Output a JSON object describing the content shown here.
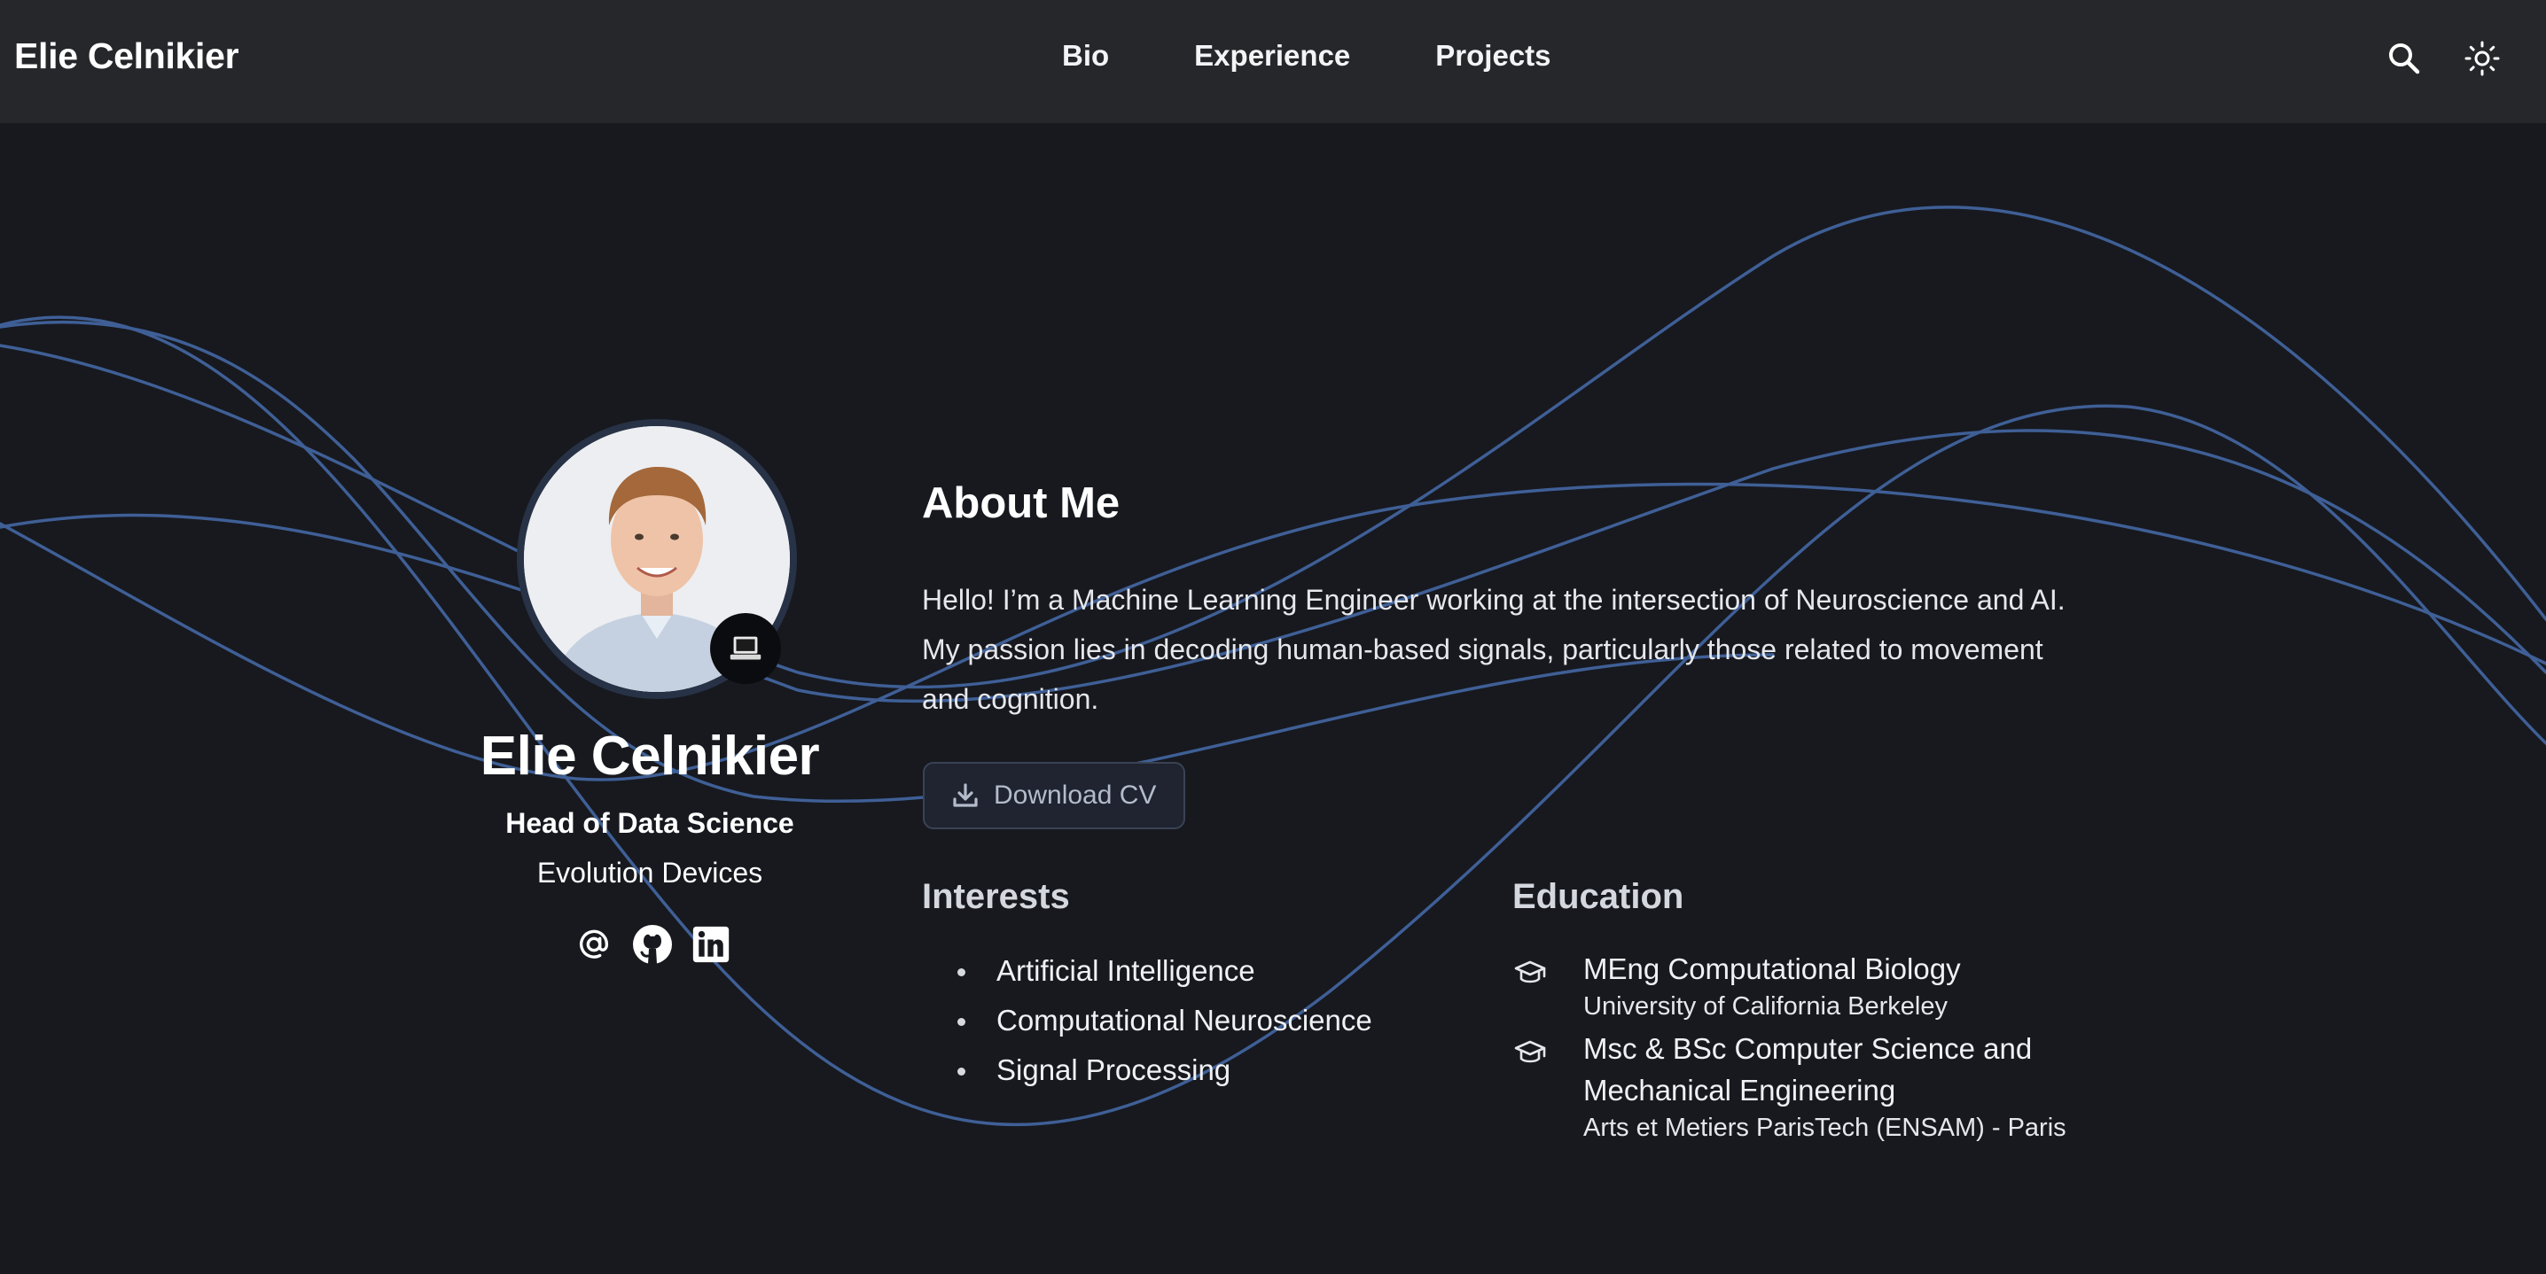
{
  "navbar": {
    "brand": "Elie Celnikier",
    "links": [
      "Bio",
      "Experience",
      "Projects"
    ],
    "icons": [
      "search-icon",
      "sun-icon"
    ]
  },
  "profile": {
    "name": "Elie Celnikier",
    "role": "Head of Data Science",
    "organization": "Evolution Devices",
    "avatar_badge_icon": "laptop-icon",
    "socials": [
      "email-icon",
      "github-icon",
      "linkedin-icon"
    ]
  },
  "about": {
    "title": "About Me",
    "text": "Hello! I’m a Machine Learning Engineer working at the intersection of Neuroscience and AI. My passion lies in decoding human-based signals, particularly those related to movement and cognition.",
    "cv_button": "Download CV"
  },
  "interests": {
    "title": "Interests",
    "items": [
      "Artificial Intelligence",
      "Computational Neuroscience",
      "Signal Processing"
    ]
  },
  "education": {
    "title": "Education",
    "items": [
      {
        "degree": "MEng Computational Biology",
        "school": "University of California Berkeley"
      },
      {
        "degree": "Msc & BSc Computer Science and Mechanical Engineering",
        "school": "Arts et Metiers ParisTech (ENSAM) - Paris"
      }
    ]
  },
  "colors": {
    "background": "#17191f",
    "navbar": "#26272b",
    "wave": "#3f5f96",
    "button_border": "#3a4354"
  }
}
